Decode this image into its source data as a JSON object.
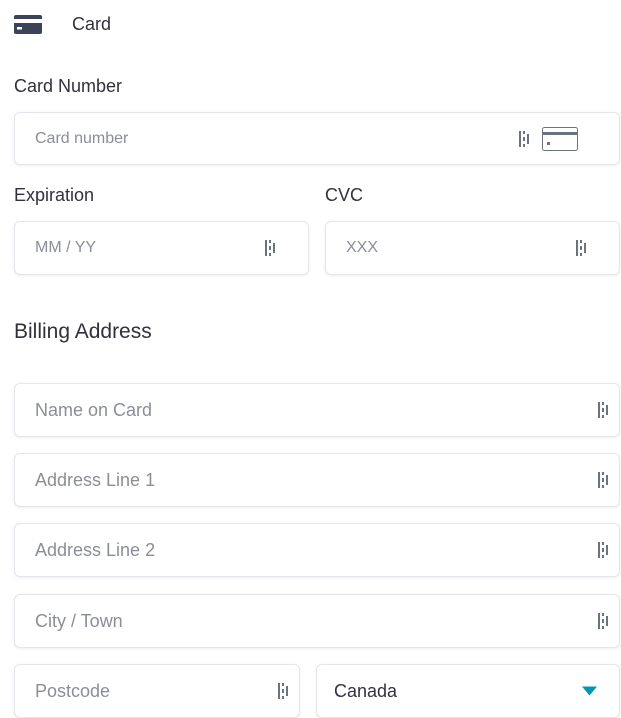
{
  "tab": {
    "label": "Card",
    "icon": "credit-card-icon"
  },
  "card_number": {
    "label": "Card Number",
    "placeholder": "Card number",
    "value": "",
    "icons": [
      "autofill-icon",
      "card-brand-icon"
    ]
  },
  "expiration": {
    "label": "Expiration",
    "placeholder": "MM / YY",
    "value": "",
    "icon": "autofill-icon"
  },
  "cvc": {
    "label": "CVC",
    "placeholder": "XXX",
    "value": "",
    "icon": "autofill-icon"
  },
  "billing": {
    "heading": "Billing Address",
    "name_on_card": {
      "placeholder": "Name on Card",
      "value": ""
    },
    "address_line_1": {
      "placeholder": "Address Line 1",
      "value": ""
    },
    "address_line_2": {
      "placeholder": "Address Line 2",
      "value": ""
    },
    "city": {
      "placeholder": "City / Town",
      "value": ""
    },
    "postcode": {
      "placeholder": "Postcode",
      "value": ""
    },
    "country": {
      "selected": "Canada",
      "icon": "chevron-down-icon"
    }
  },
  "colors": {
    "text": "#30313d",
    "placeholder": "#8b8e98",
    "border": "#e3e6ea",
    "accent": "#0095b6",
    "icon": "#3c4257"
  }
}
